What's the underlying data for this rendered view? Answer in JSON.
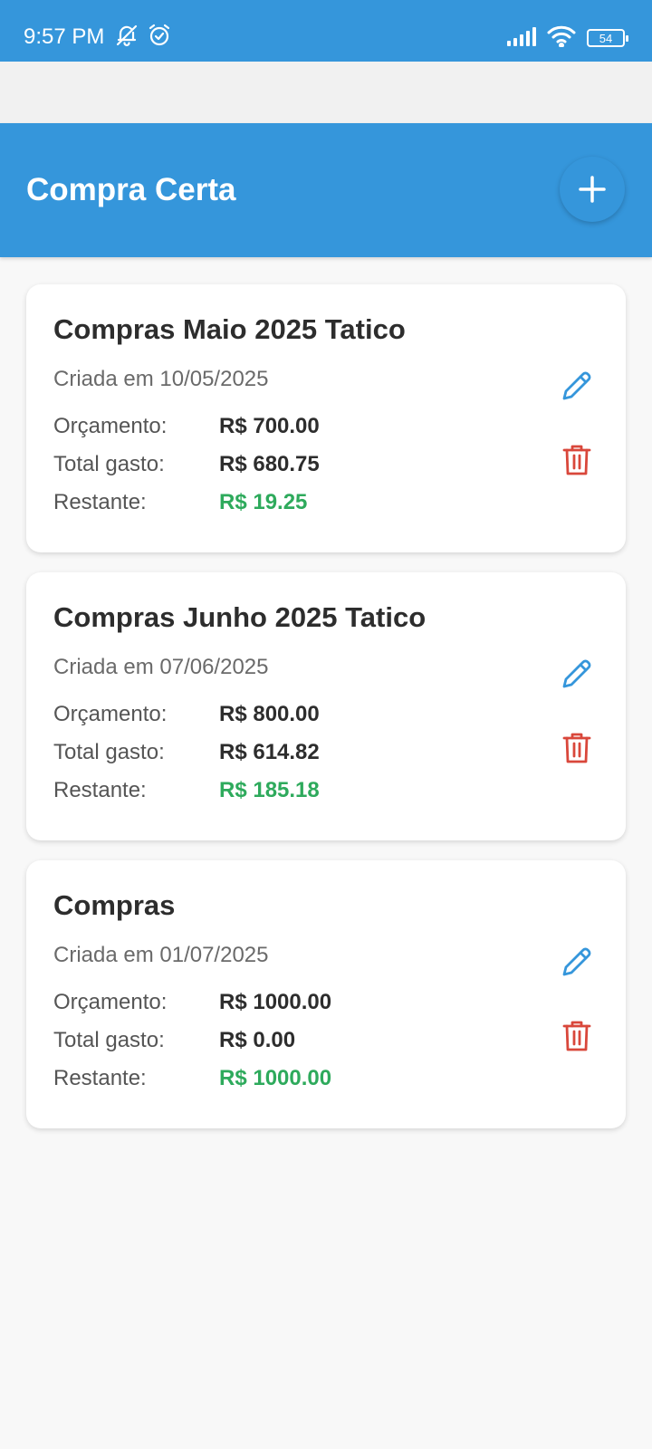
{
  "status_bar": {
    "time": "9:57 PM",
    "battery": "54",
    "icons": [
      "mute-notifications-icon",
      "alarm-icon",
      "signal-icon",
      "wifi-icon",
      "battery-icon"
    ]
  },
  "header": {
    "title": "Compra Certa",
    "add_icon": "plus-icon"
  },
  "labels": {
    "budget": "Orçamento:",
    "spent": "Total gasto:",
    "remaining": "Restante:"
  },
  "lists": [
    {
      "name": "Compras Maio 2025 Tatico",
      "created": "Criada em 10/05/2025",
      "budget": "R$ 700.00",
      "spent": "R$ 680.75",
      "remaining": "R$ 19.25"
    },
    {
      "name": "Compras Junho 2025 Tatico",
      "created": "Criada em 07/06/2025",
      "budget": "R$ 800.00",
      "spent": "R$ 614.82",
      "remaining": "R$ 185.18"
    },
    {
      "name": "Compras",
      "created": "Criada em 01/07/2025",
      "budget": "R$ 1000.00",
      "spent": "R$ 0.00",
      "remaining": "R$ 1000.00"
    }
  ],
  "colors": {
    "primary": "#3596db",
    "remaining_green": "#2eaa5c",
    "edit_blue": "#3596db",
    "delete_red": "#d9473b",
    "background": "#f8f8f8"
  }
}
